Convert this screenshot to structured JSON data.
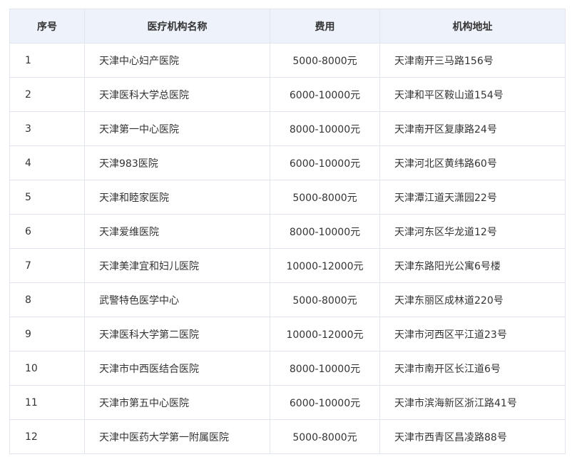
{
  "table": {
    "headers": [
      "序号",
      "医疗机构名称",
      "费用",
      "机构地址"
    ],
    "rows": [
      [
        "1",
        "天津中心妇产医院",
        "5000-8000元",
        "天津南开三马路156号"
      ],
      [
        "2",
        "天津医科大学总医院",
        "6000-10000元",
        "天津和平区鞍山道154号"
      ],
      [
        "3",
        "天津第一中心医院",
        "8000-10000元",
        "天津南开区复康路24号"
      ],
      [
        "4",
        "天津983医院",
        "6000-10000元",
        "天津河北区黄纬路60号"
      ],
      [
        "5",
        "天津和睦家医院",
        "5000-8000元",
        "天津潭江道天潇园22号"
      ],
      [
        "6",
        "天津爱维医院",
        "8000-10000元",
        "天津河东区华龙道12号"
      ],
      [
        "7",
        "天津美津宜和妇儿医院",
        "10000-12000元",
        "天津东路阳光公寓6号楼"
      ],
      [
        "8",
        "武警特色医学中心",
        "5000-8000元",
        "天津东丽区成林道220号"
      ],
      [
        "9",
        "天津医科大学第二医院",
        "10000-12000元",
        "天津市河西区平江道23号"
      ],
      [
        "10",
        "天津市中西医结合医院",
        "8000-10000元",
        "天津市南开区长江道6号"
      ],
      [
        "11",
        "天津市第五中心医院",
        "6000-10000元",
        "天津市滨海新区浙江路41号"
      ],
      [
        "12",
        "天津中医药大学第一附属医院",
        "5000-8000元",
        "天津市西青区昌凌路88号"
      ]
    ]
  }
}
